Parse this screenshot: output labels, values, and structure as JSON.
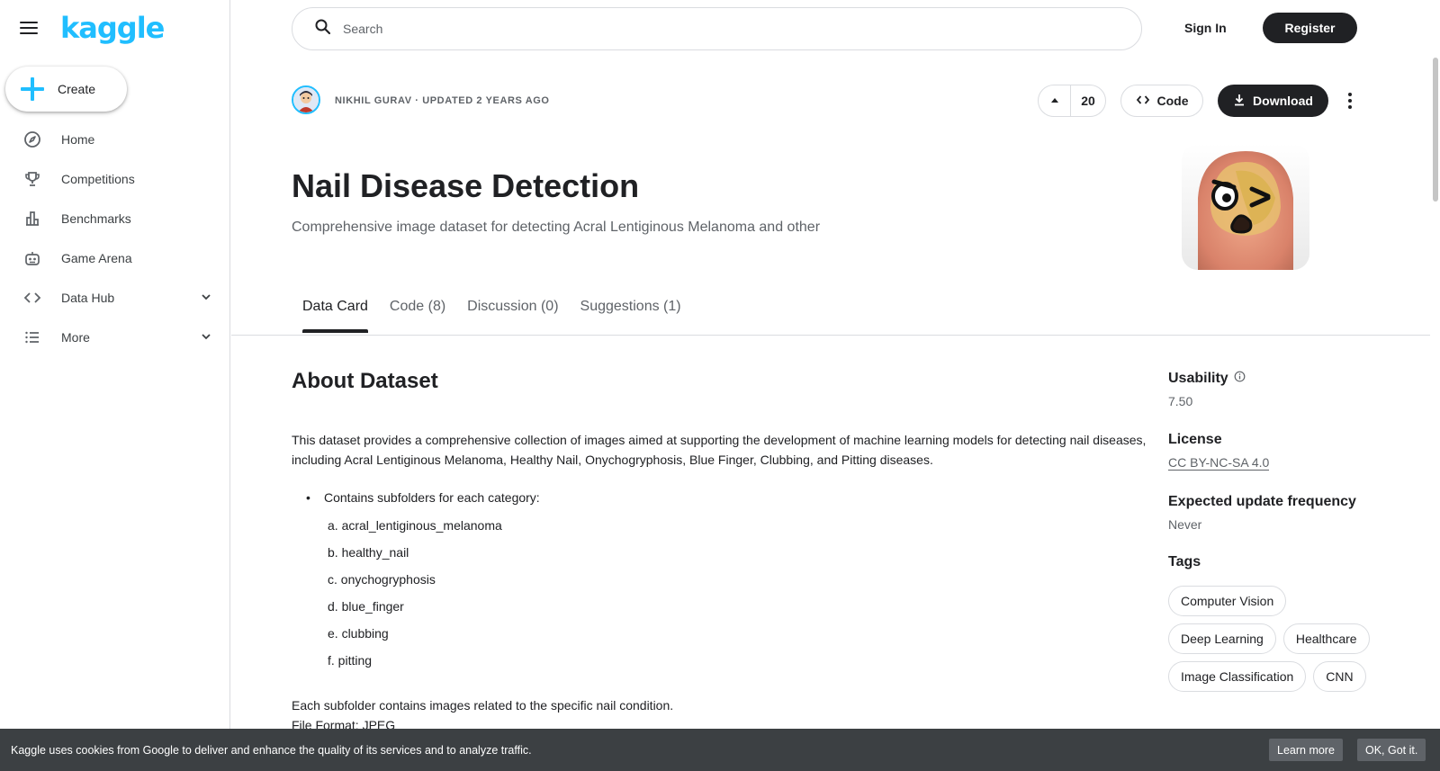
{
  "sidebar": {
    "logo": "kaggle",
    "create_label": "Create",
    "items": [
      {
        "label": "Home",
        "icon": "compass-icon"
      },
      {
        "label": "Competitions",
        "icon": "trophy-icon"
      },
      {
        "label": "Benchmarks",
        "icon": "bar-chart-icon"
      },
      {
        "label": "Game Arena",
        "icon": "robot-icon"
      },
      {
        "label": "Data Hub",
        "icon": "code-brackets-icon"
      },
      {
        "label": "More",
        "icon": "list-icon"
      }
    ]
  },
  "topbar": {
    "search_placeholder": "Search",
    "signin_label": "Sign In",
    "register_label": "Register"
  },
  "dataset": {
    "author_line": "NIKHIL GURAV · UPDATED 2 YEARS AGO",
    "upvotes": "20",
    "code_label": "Code",
    "download_label": "Download",
    "title": "Nail Disease Detection",
    "subtitle": "Comprehensive image dataset for detecting Acral Lentiginous Melanoma and other"
  },
  "tabs": [
    {
      "label": "Data Card",
      "active": true
    },
    {
      "label": "Code (8)",
      "active": false
    },
    {
      "label": "Discussion (0)",
      "active": false
    },
    {
      "label": "Suggestions (1)",
      "active": false
    }
  ],
  "content": {
    "about_title": "About Dataset",
    "description": "This dataset provides a comprehensive collection of images aimed at supporting the development of machine learning models for detecting nail diseases, including Acral Lentiginous Melanoma, Healthy Nail, Onychogryphosis, Blue Finger, Clubbing, and Pitting diseases.",
    "bullet": "Contains subfolders for each category:",
    "categories": [
      "a. acral_lentiginous_melanoma",
      "b. healthy_nail",
      "c. onychogryphosis",
      "d. blue_finger",
      "e. clubbing",
      "f. pitting"
    ],
    "note_line1": "Each subfolder contains images related to the specific nail condition.",
    "note_line2": "File Format: JPEG"
  },
  "panel": {
    "usability_label": "Usability",
    "usability_value": "7.50",
    "license_label": "License",
    "license_value": "CC BY-NC-SA 4.0",
    "frequency_label": "Expected update frequency",
    "frequency_value": "Never",
    "tags_label": "Tags",
    "tags": [
      "Computer Vision",
      "Deep Learning",
      "Healthcare",
      "Image Classification",
      "CNN"
    ]
  },
  "cookie": {
    "text": "Kaggle uses cookies from Google to deliver and enhance the quality of its services and to analyze traffic.",
    "learn_more": "Learn more",
    "ok": "OK, Got it."
  },
  "colors": {
    "brand": "#20beff",
    "dark_button": "#202124",
    "cookie_bg": "#3c4043"
  }
}
